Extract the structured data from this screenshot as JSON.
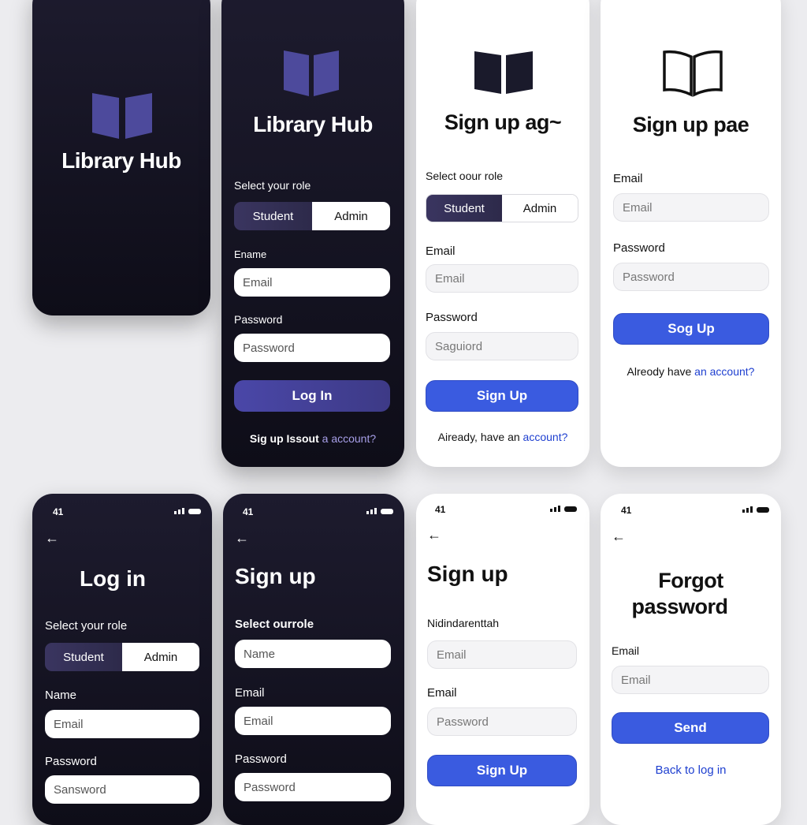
{
  "splash": {
    "app_name": "Library Hub"
  },
  "login_top": {
    "app_name": "Library Hub",
    "role_label": "Select your role",
    "role_student": "Student",
    "role_admin": "Admin",
    "email_label": "Ename",
    "email_placeholder": "Email",
    "password_label": "Password",
    "password_placeholder": "Password",
    "login_button": "Log In",
    "footer_text": "Sig up Issout",
    "footer_link": "a account?"
  },
  "signup_a": {
    "title": "Sign up ag~",
    "role_label": "Select oour role",
    "role_student": "Student",
    "role_admin": "Admin",
    "email_label": "Email",
    "email_placeholder": "Email",
    "password_label": "Password",
    "password_placeholder": "Saguiord",
    "signup_button": "Sign Up",
    "footer_text": "Aiready, have an",
    "footer_link": "account?"
  },
  "signup_b": {
    "title": "Sign up pae",
    "email_label": "Email",
    "email_placeholder": "Email",
    "password_label": "Password",
    "password_placeholder": "Password",
    "signup_button": "Sog Up",
    "footer_text": "Alreody have",
    "footer_link": "an account?"
  },
  "login_bottom": {
    "status_time": "41",
    "title": "Log in",
    "role_label": "Select your role",
    "role_student": "Student",
    "role_admin": "Admin",
    "name_label": "Name",
    "email_placeholder": "Email",
    "password_label": "Password",
    "password_placeholder": "Sansword"
  },
  "signup_dark": {
    "status_time": "41",
    "title": "Sign up",
    "role_label": "Select ourrole",
    "name_placeholder": "Name",
    "email_label": "Email",
    "email_placeholder": "Email",
    "password_label": "Password",
    "password_placeholder": "Password"
  },
  "signup_light": {
    "status_time": "41",
    "title": "Sign up",
    "name_label": "Nidindarenttah",
    "email_placeholder": "Email",
    "email_label": "Email",
    "password_placeholder": "Password",
    "signup_button": "Sign Up"
  },
  "forgot": {
    "status_time": "41",
    "title_line1": "Forgot",
    "title_line2": "password",
    "email_label": "Email",
    "email_placeholder": "Email",
    "send_button": "Send",
    "back_link": "Back to log in"
  },
  "colors": {
    "dark_bg": "#1d1b2e",
    "accent_blue": "#3a5be0",
    "accent_purple": "#4a47a8",
    "book_purple": "#4d4a9c"
  },
  "icons": {
    "book": "open-book-icon",
    "back": "back-arrow-icon",
    "signal": "signal-icon",
    "battery": "battery-icon"
  }
}
